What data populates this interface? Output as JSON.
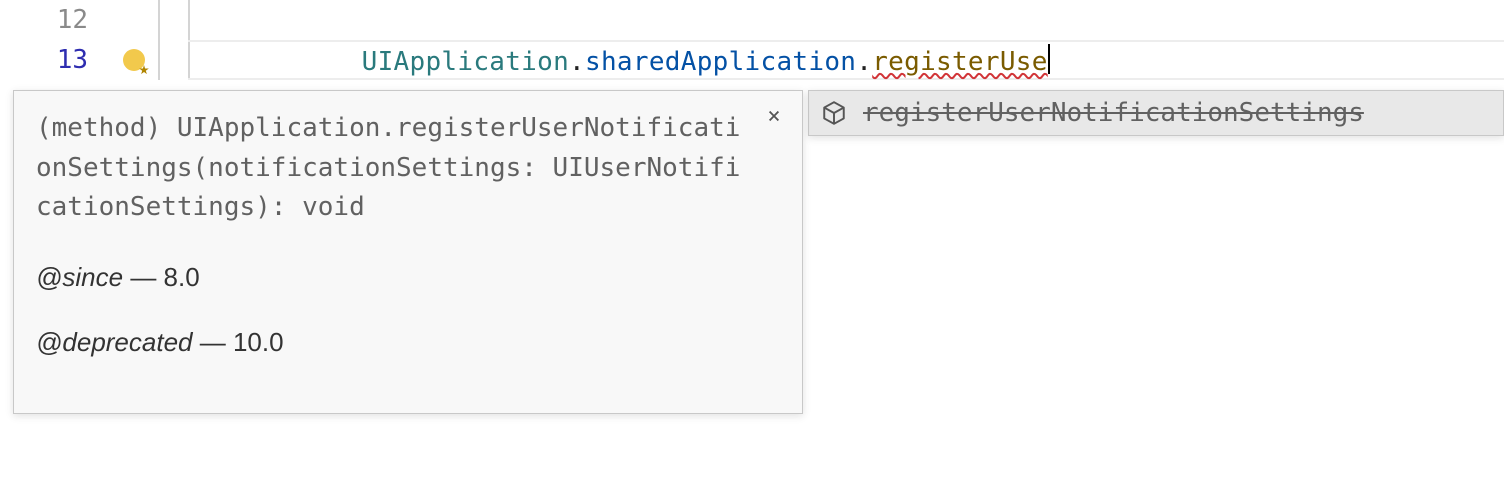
{
  "editor": {
    "lines": [
      {
        "number": "12",
        "active": false
      },
      {
        "number": "13",
        "active": true
      }
    ],
    "code": {
      "segment1": "UIApplication",
      "dot1": ".",
      "segment2": "sharedApplication",
      "dot2": ".",
      "segment3": "registerUse"
    },
    "lightbulb_tooltip": "Show Code Actions"
  },
  "hover": {
    "signature": "(method) UIApplication.registerUserNotificationSettings(notificationSettings: UIUserNotificationSettings): void",
    "doc": {
      "since_tag": "@since",
      "since_value": "8.0",
      "deprecated_tag": "@deprecated",
      "deprecated_value": "10.0",
      "dash": " — "
    },
    "close_label": "×"
  },
  "suggest": {
    "items": [
      {
        "label": "registerUserNotificationSettings",
        "deprecated": true,
        "kind": "method"
      }
    ]
  }
}
